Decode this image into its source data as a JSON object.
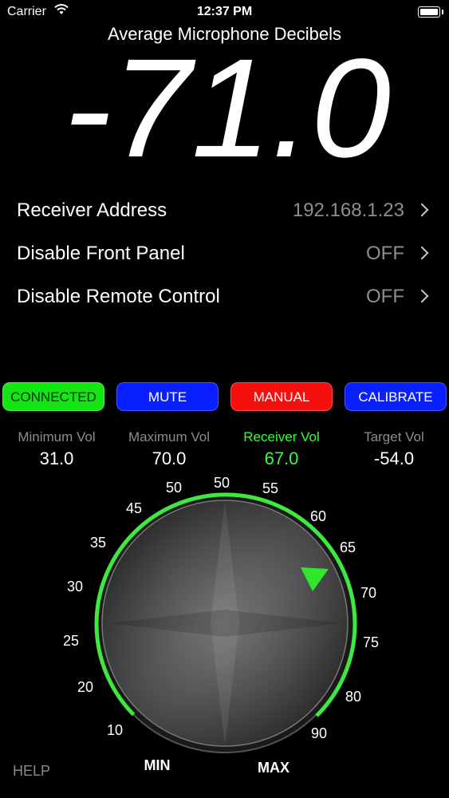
{
  "status_bar": {
    "carrier": "Carrier",
    "time": "12:37 PM"
  },
  "meter": {
    "title": "Average Microphone Decibels",
    "reading": "-71.0"
  },
  "settings": [
    {
      "label": "Receiver Address",
      "value": "192.168.1.23"
    },
    {
      "label": "Disable Front Panel",
      "value": "OFF"
    },
    {
      "label": "Disable Remote Control",
      "value": "OFF"
    }
  ],
  "buttons": {
    "connected": "CONNECTED",
    "mute": "MUTE",
    "manual": "MANUAL",
    "calibrate": "CALIBRATE"
  },
  "stats": {
    "min": {
      "label": "Minimum Vol",
      "value": "31.0"
    },
    "max": {
      "label": "Maximum Vol",
      "value": "70.0"
    },
    "receiver": {
      "label": "Receiver Vol",
      "value": "67.0"
    },
    "target": {
      "label": "Target Vol",
      "value": "-54.0"
    }
  },
  "dial": {
    "ticks": [
      "10",
      "20",
      "25",
      "30",
      "35",
      "45",
      "50",
      "50",
      "55",
      "60",
      "65",
      "70",
      "75",
      "80",
      "90"
    ],
    "min_label": "MIN",
    "max_label": "MAX",
    "current_level": 67
  },
  "help_label": "HELP",
  "colors": {
    "connected": "#14e614",
    "mute": "#0a1fff",
    "manual": "#f51010",
    "calibrate": "#0a1fff",
    "receiver_highlight": "#36ff36",
    "dial_ring": "#3ee83e"
  },
  "icons": {
    "wifi": "wifi-icon",
    "battery": "battery-icon",
    "chevron": "chevron-right-icon",
    "pointer": "triangle-pointer-icon"
  }
}
